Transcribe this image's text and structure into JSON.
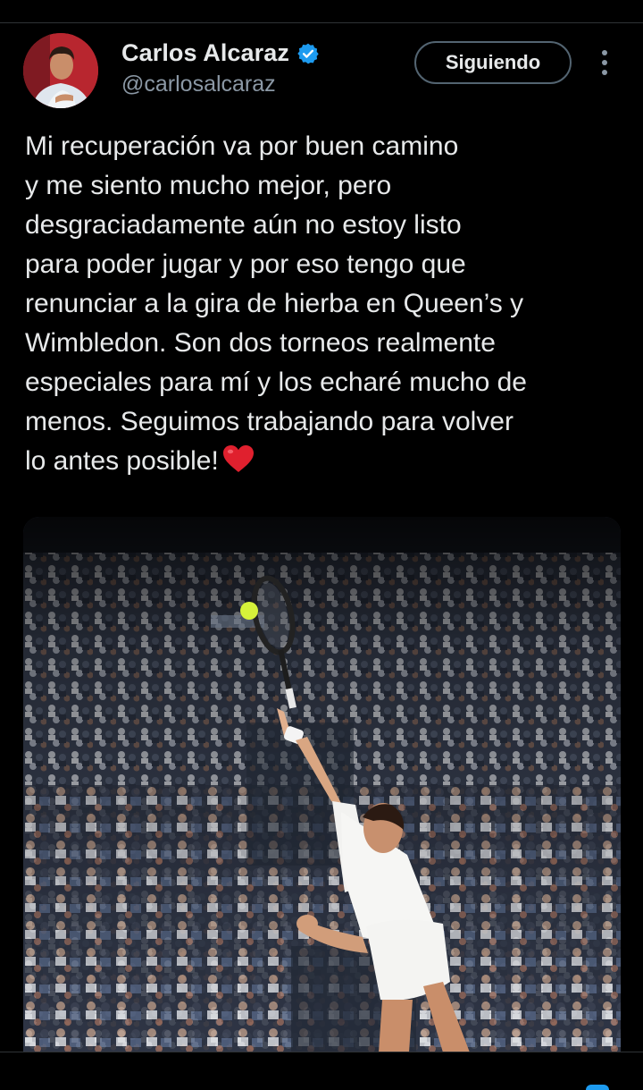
{
  "tweet": {
    "author": {
      "name": "Carlos Alcaraz",
      "handle": "@carlosalcaraz",
      "verified": true,
      "verified_icon": "verified-badge-icon",
      "verified_color": "#1d9bf0"
    },
    "follow_button": {
      "label": "Siguiendo"
    },
    "more_icon": "more-vertical-icon",
    "text_lines": [
      "Mi recuperación va por buen camino",
      "y me siento mucho mejor, pero",
      "desgraciadamente aún no estoy listo",
      "para poder jugar y por eso tengo que",
      "renunciar a la gira de hierba en Queen’s y",
      "Wimbledon. Son dos torneos realmente",
      "especiales para mí y los echaré mucho de",
      "menos. Seguimos trabajando para volver",
      "lo antes posible!"
    ],
    "emoji": "red-heart-icon",
    "media": {
      "kind": "photo",
      "subject": "tennis-player-serving-photo"
    }
  },
  "colors": {
    "background": "#000000",
    "text": "#e7e9ea",
    "secondary_text": "#8b98a5",
    "border": "#536471",
    "heart": "#e0202e"
  }
}
